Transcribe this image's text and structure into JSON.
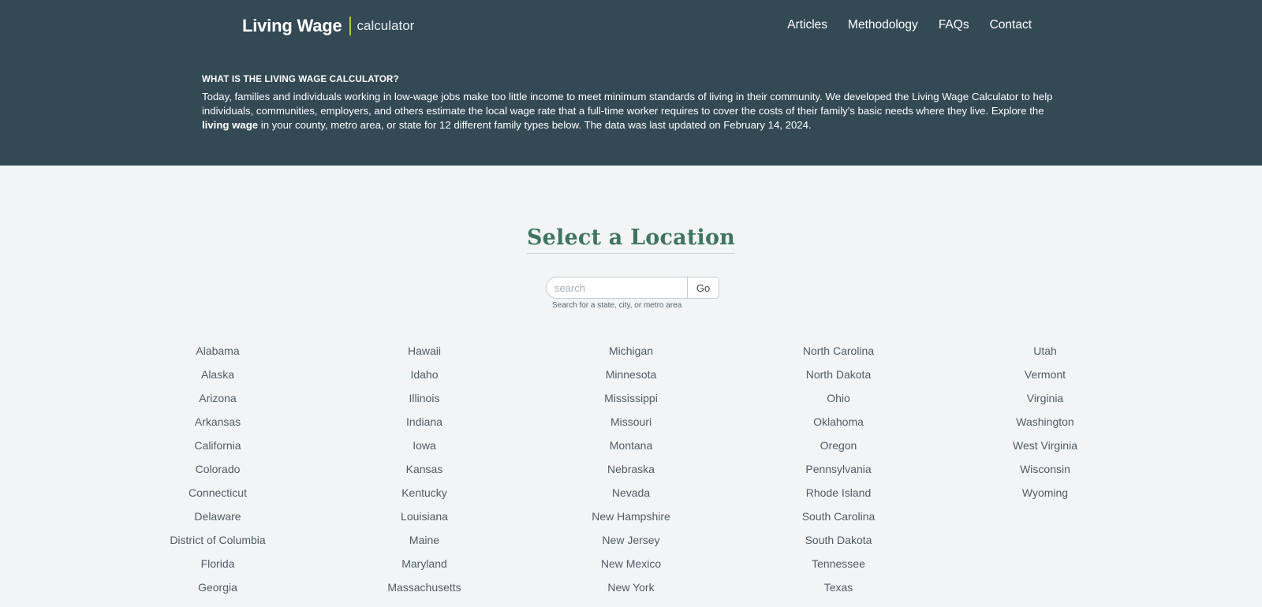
{
  "header": {
    "logo_main": "Living Wage",
    "logo_sub": "calculator",
    "nav": [
      "Articles",
      "Methodology",
      "FAQs",
      "Contact"
    ]
  },
  "intro": {
    "heading": "WHAT IS THE LIVING WAGE CALCULATOR?",
    "text_part1": "Today, families and individuals working in low-wage jobs make too little income to meet minimum standards of living in their community. We developed the Living Wage Calculator to help individuals, communities, employers, and others estimate the local wage rate that a full-time worker requires to cover the costs of their family's basic needs where they live. Explore the ",
    "text_bold": "living wage",
    "text_part2": " in your county, metro area, or state for 12 different family types below. The data was last updated on February 14, 2024."
  },
  "location": {
    "title": "Select a Location",
    "search_placeholder": "search",
    "go_label": "Go",
    "help_text": "Search for a state, city, or metro area"
  },
  "states": [
    [
      "Alabama",
      "Alaska",
      "Arizona",
      "Arkansas",
      "California",
      "Colorado",
      "Connecticut",
      "Delaware",
      "District of Columbia",
      "Florida",
      "Georgia"
    ],
    [
      "Hawaii",
      "Idaho",
      "Illinois",
      "Indiana",
      "Iowa",
      "Kansas",
      "Kentucky",
      "Louisiana",
      "Maine",
      "Maryland",
      "Massachusetts"
    ],
    [
      "Michigan",
      "Minnesota",
      "Mississippi",
      "Missouri",
      "Montana",
      "Nebraska",
      "Nevada",
      "New Hampshire",
      "New Jersey",
      "New Mexico",
      "New York"
    ],
    [
      "North Carolina",
      "North Dakota",
      "Ohio",
      "Oklahoma",
      "Oregon",
      "Pennsylvania",
      "Rhode Island",
      "South Carolina",
      "South Dakota",
      "Tennessee",
      "Texas"
    ],
    [
      "Utah",
      "Vermont",
      "Virginia",
      "Washington",
      "West Virginia",
      "Wisconsin",
      "Wyoming"
    ]
  ],
  "colors": {
    "header_bg": "#334954",
    "accent_divider": "#b6c83a",
    "title_green": "#3e7560",
    "page_bg": "#f3f4f6"
  }
}
